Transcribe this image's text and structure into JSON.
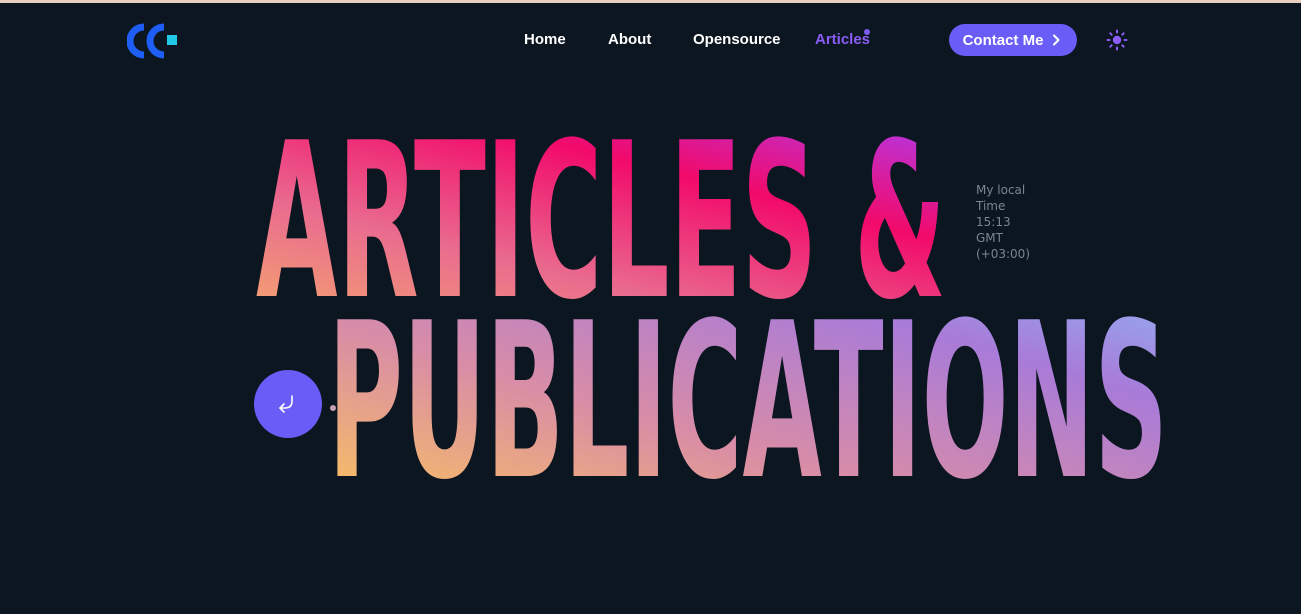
{
  "brand": {
    "logo_icon": "cc-logo-icon",
    "colors": {
      "primary": "#1f5ef5",
      "secondary": "#22c9e6"
    }
  },
  "nav": {
    "items": [
      {
        "label": "Home",
        "active": false
      },
      {
        "label": "About",
        "active": false
      },
      {
        "label": "Opensource",
        "active": false
      },
      {
        "label": "Articles",
        "active": true
      }
    ],
    "active_color": "#8b5cf6"
  },
  "contact": {
    "label": "Contact Me",
    "icon": "chevron-right-icon"
  },
  "theme_toggle": {
    "icon": "sun-icon"
  },
  "hero": {
    "line1": "ARTICLES &",
    "line2": "PUBLICATIONS",
    "gradient": {
      "line1": [
        "#f7b267",
        "#e96b8f",
        "#f20a6a",
        "#c02fcf"
      ],
      "line2": [
        "#ffc857",
        "#d98da6",
        "#a87bd9",
        "#8fb5f5"
      ]
    }
  },
  "local_time": {
    "lines": [
      "My local",
      "Time",
      "15:13",
      "GMT",
      "(+03:00)"
    ]
  },
  "scroll_button": {
    "icon": "arrow-down-left-icon"
  },
  "colors": {
    "background": "#0b1620",
    "accent": "#6a5cf6",
    "muted_text": "#7b8394"
  }
}
